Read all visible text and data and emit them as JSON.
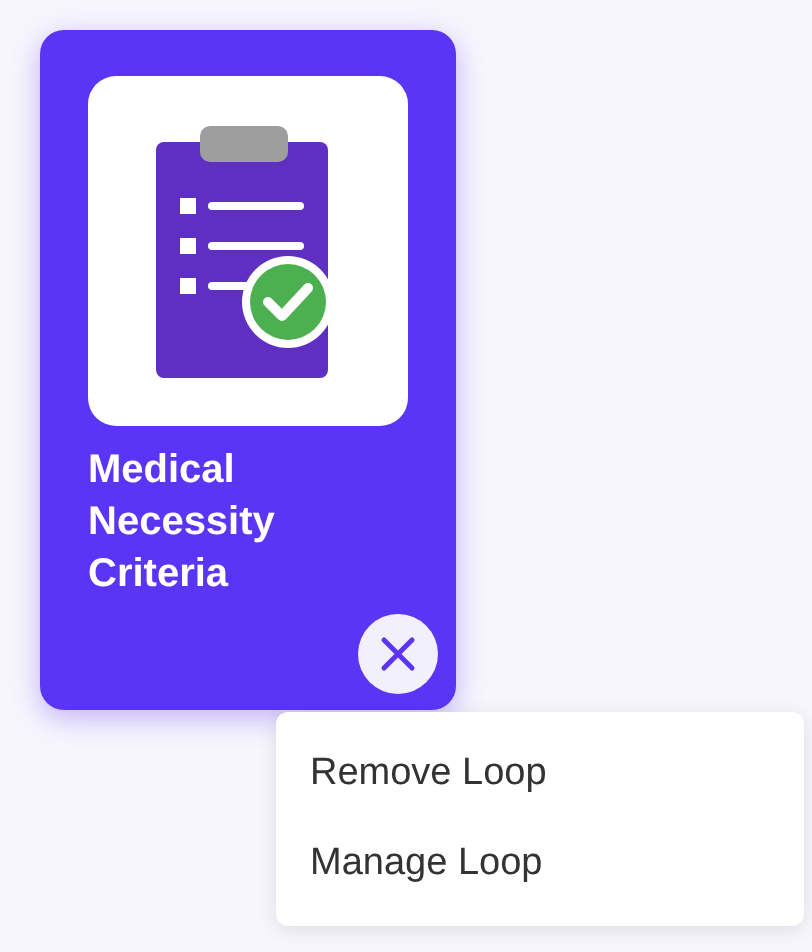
{
  "card": {
    "title": "Medical Necessity Criteria"
  },
  "menu": {
    "items": [
      {
        "label": "Remove Loop"
      },
      {
        "label": "Manage Loop"
      }
    ]
  }
}
